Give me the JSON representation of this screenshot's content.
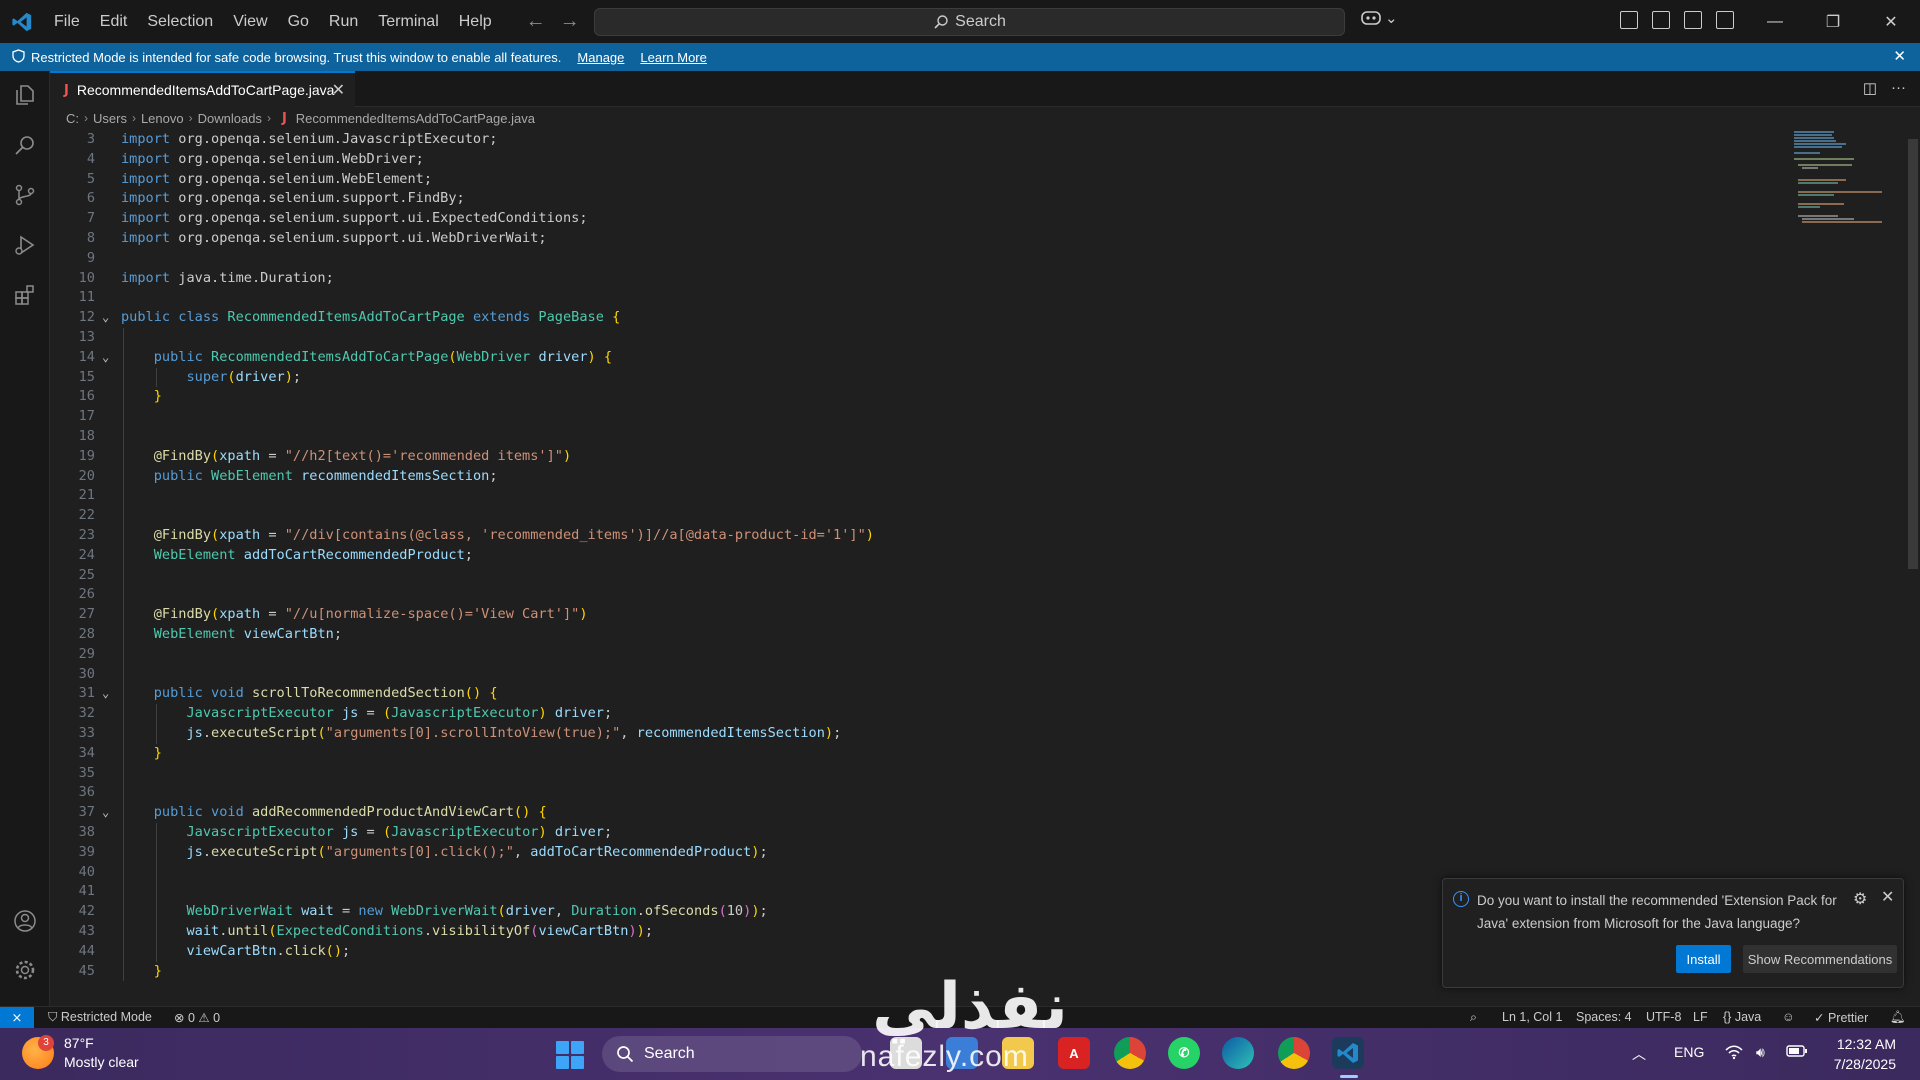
{
  "titlebar": {
    "menu": [
      "File",
      "Edit",
      "Selection",
      "View",
      "Go",
      "Run",
      "Terminal",
      "Help"
    ],
    "search_label": "Search"
  },
  "banner": {
    "message": "Restricted Mode is intended for safe code browsing. Trust this window to enable all features.",
    "manage": "Manage",
    "learn_more": "Learn More"
  },
  "tab": {
    "icon": "J",
    "filename": "RecommendedItemsAddToCartPage.java"
  },
  "breadcrumb": {
    "parts": [
      "C:",
      "Users",
      "Lenovo",
      "Downloads"
    ],
    "icon": "J",
    "file": "RecommendedItemsAddToCartPage.java"
  },
  "editor": {
    "line_numbers": [
      "3",
      "4",
      "5",
      "6",
      "7",
      "8",
      "9",
      "10",
      "11",
      "12",
      "13",
      "14",
      "15",
      "16",
      "17",
      "18",
      "19",
      "20",
      "21",
      "22",
      "23",
      "24",
      "25",
      "26",
      "27",
      "28",
      "29",
      "30",
      "31",
      "32",
      "33",
      "34",
      "35",
      "36",
      "37",
      "38",
      "39",
      "40",
      "41",
      "42",
      "43",
      "44",
      "45"
    ],
    "lines": [
      "import org.openqa.selenium.JavascriptExecutor;",
      "import org.openqa.selenium.WebDriver;",
      "import org.openqa.selenium.WebElement;",
      "import org.openqa.selenium.support.FindBy;",
      "import org.openqa.selenium.support.ui.ExpectedConditions;",
      "import org.openqa.selenium.support.ui.WebDriverWait;",
      "",
      "import java.time.Duration;",
      "",
      "public class RecommendedItemsAddToCartPage extends PageBase {",
      "",
      "    public RecommendedItemsAddToCartPage(WebDriver driver) {",
      "        super(driver);",
      "    }",
      "",
      "",
      "    @FindBy(xpath = \"//h2[text()='recommended items']\")",
      "    public WebElement recommendedItemsSection;",
      "",
      "",
      "    @FindBy(xpath = \"//div[contains(@class, 'recommended_items')]//a[@data-product-id='1']\")",
      "    WebElement addToCartRecommendedProduct;",
      "",
      "",
      "    @FindBy(xpath = \"//u[normalize-space()='View Cart']\")",
      "    WebElement viewCartBtn;",
      "",
      "",
      "    public void scrollToRecommendedSection() {",
      "        JavascriptExecutor js = (JavascriptExecutor) driver;",
      "        js.executeScript(\"arguments[0].scrollIntoView(true);\", recommendedItemsSection);",
      "    }",
      "",
      "",
      "    public void addRecommendedProductAndViewCart() {",
      "        JavascriptExecutor js = (JavascriptExecutor) driver;",
      "        js.executeScript(\"arguments[0].click();\", addToCartRecommendedProduct);",
      "",
      "",
      "        WebDriverWait wait = new WebDriverWait(driver, Duration.ofSeconds(10));",
      "        wait.until(ExpectedConditions.visibilityOf(viewCartBtn));",
      "        viewCartBtn.click();",
      "    }"
    ]
  },
  "notification": {
    "message": "Do you want to install the recommended 'Extension Pack for Java' extension from Microsoft for the Java language?",
    "install": "Install",
    "show_recommendations": "Show Recommendations"
  },
  "statusbar": {
    "restricted": "Restricted Mode",
    "errors": "0",
    "warnings": "0",
    "position": "Ln 1, Col 1",
    "spaces": "Spaces: 4",
    "encoding": "UTF-8",
    "eol": "LF",
    "language": "Java",
    "prettier": "Prettier"
  },
  "taskbar": {
    "weather_temp": "87°F",
    "weather_desc": "Mostly clear",
    "weather_badge": "3",
    "search": "Search",
    "lang": "ENG",
    "time": "12:32 AM",
    "date": "7/28/2025"
  },
  "watermark": {
    "arabic": "نفذلي",
    "url": "nafezly.com"
  },
  "colors": {
    "accent": "#0078d4",
    "banner": "#0e639c",
    "editor_bg": "#1f1f1f"
  }
}
